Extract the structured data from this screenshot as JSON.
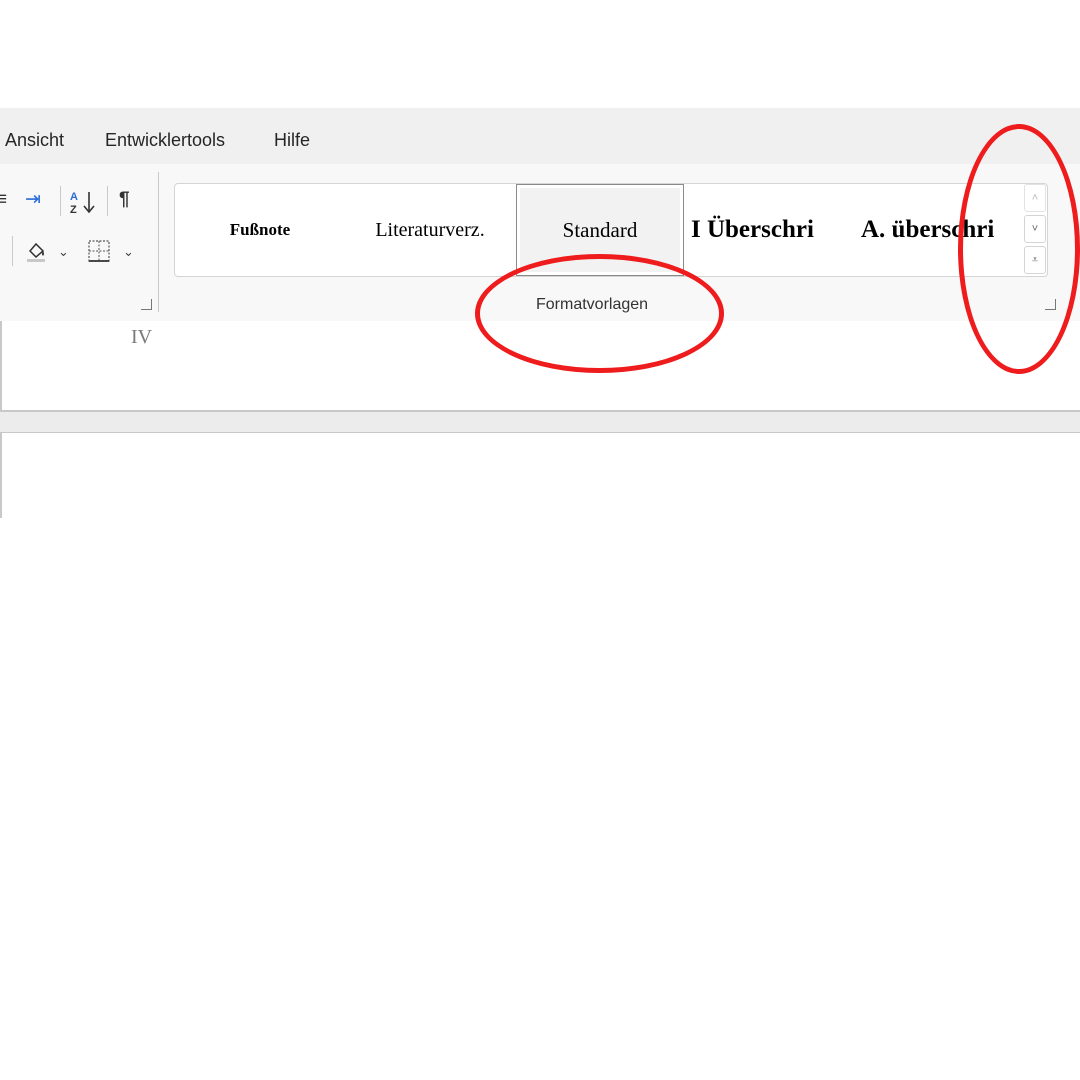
{
  "menu": {
    "tabs": [
      {
        "label": "Ansicht"
      },
      {
        "label": "Entwicklertools"
      },
      {
        "label": "Hilfe"
      }
    ]
  },
  "paragraph": {
    "bullets_icon": "≡",
    "indent_icon": "⇥",
    "sort_icon": "A/Z↓",
    "pilcrow_label": "¶",
    "shading_icon": "◇",
    "borders_icon": "⊞",
    "dropdown_glyph": "⌄",
    "launcher_icon": "dialog-launcher"
  },
  "styles": {
    "items": [
      {
        "label": "Fußnote"
      },
      {
        "label": "Literaturverz."
      },
      {
        "label": "Standard"
      },
      {
        "label": "I  Überschri"
      },
      {
        "label": "A.  überschri"
      }
    ],
    "selected": "Standard",
    "group_label": "Formatvorlagen",
    "scroll_up_glyph": "˄",
    "scroll_down_glyph": "˅",
    "more_glyph": "⩡"
  },
  "document": {
    "page_number": "IV"
  },
  "annotation": {
    "color": "#ee1c1c"
  }
}
